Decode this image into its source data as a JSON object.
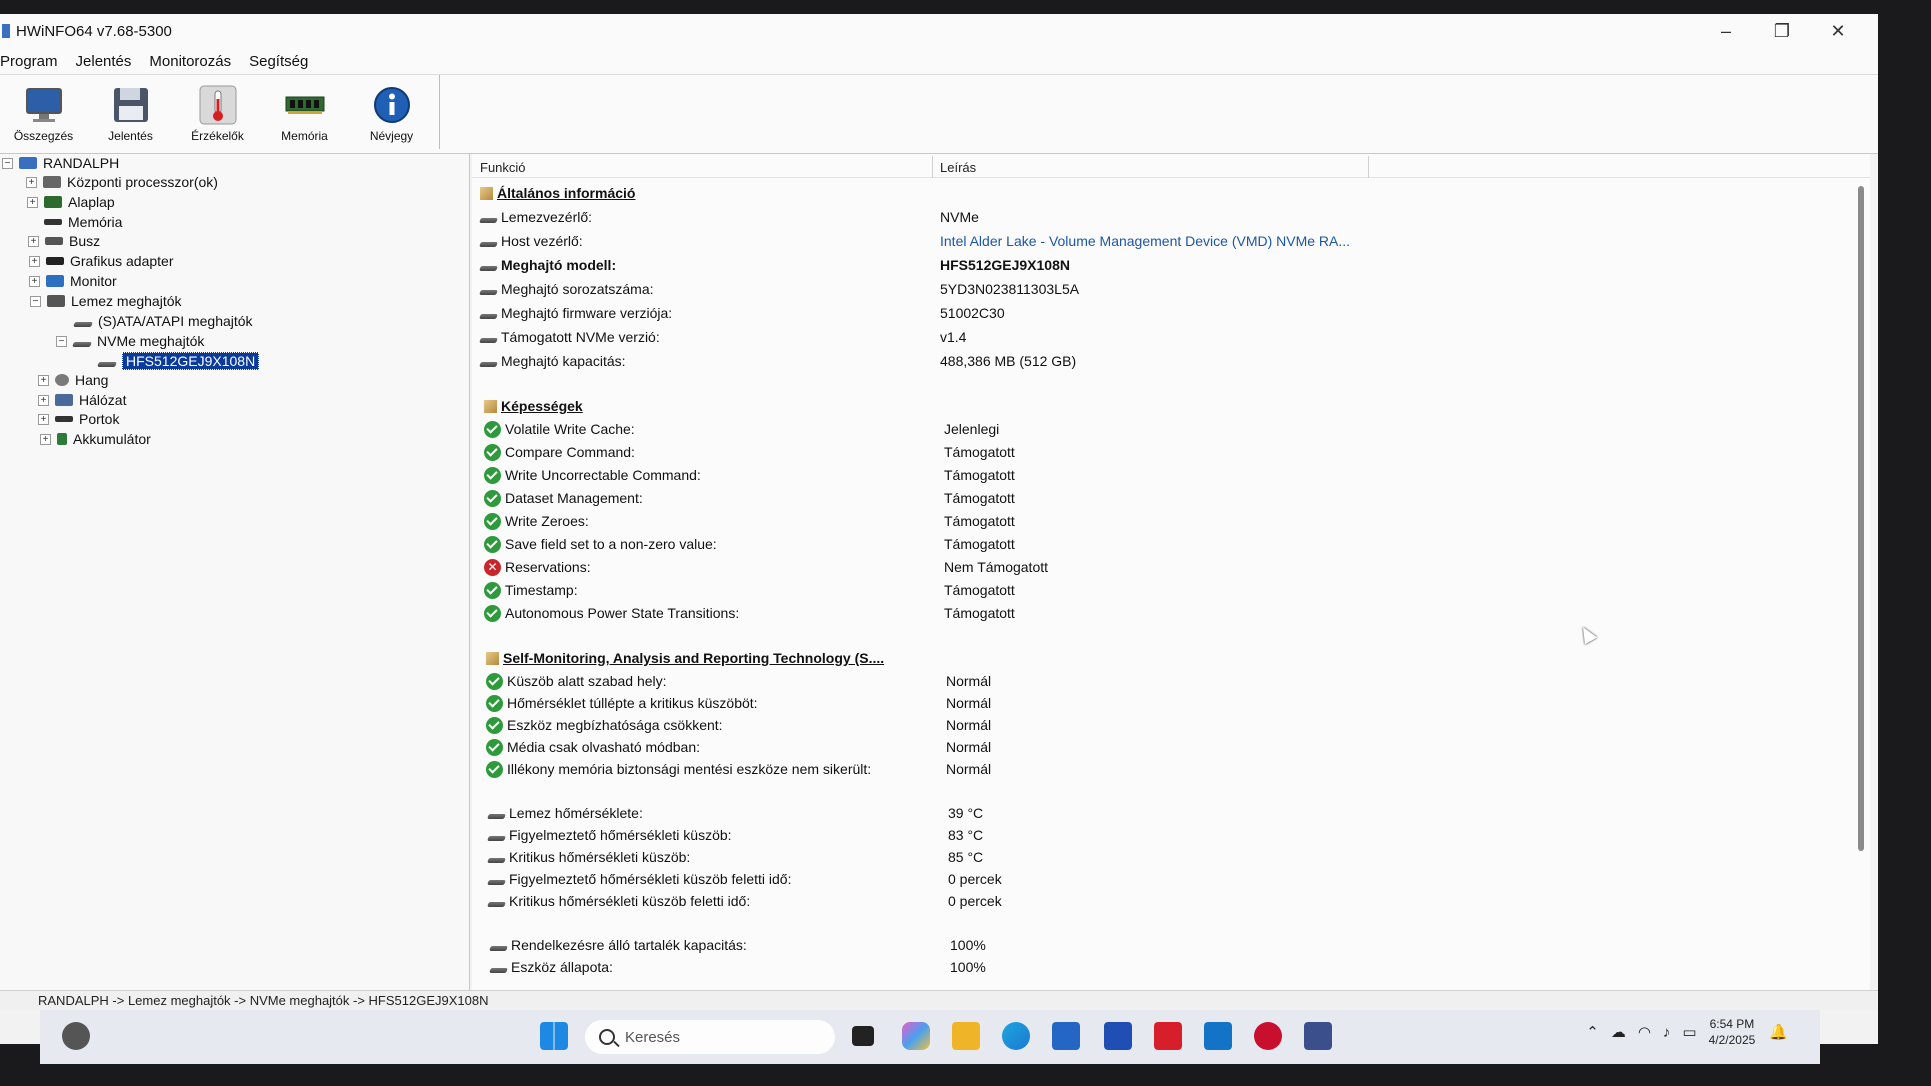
{
  "window": {
    "title": "HWiNFO64 v7.68-5300",
    "minimize_glyph": "–",
    "restore_glyph": "❐",
    "close_glyph": "✕"
  },
  "menu": [
    "Program",
    "Jelentés",
    "Monitorozás",
    "Segítség"
  ],
  "toolbar": [
    {
      "label": "Összegzés",
      "icon": "monitor-icon"
    },
    {
      "label": "Jelentés",
      "icon": "save-disk-icon"
    },
    {
      "label": "Érzékelők",
      "icon": "thermometer-icon"
    },
    {
      "label": "Memória",
      "icon": "memory-stick-icon"
    },
    {
      "label": "Névjegy",
      "icon": "info-icon"
    }
  ],
  "tree": {
    "root": "RANDALPH",
    "expand_glyph": "+",
    "collapse_glyph": "−",
    "items": [
      {
        "label": "Központi processzor(ok)",
        "icon": "cpu-icon"
      },
      {
        "label": "Alaplap",
        "icon": "motherboard-icon"
      },
      {
        "label": "Memória",
        "icon": "memory-icon"
      },
      {
        "label": "Busz",
        "icon": "bus-icon"
      },
      {
        "label": "Grafikus adapter",
        "icon": "gpu-icon"
      },
      {
        "label": "Monitor",
        "icon": "monitor-icon"
      },
      {
        "label": "Lemez meghajtók",
        "icon": "disk-icon"
      },
      {
        "label": "(S)ATA/ATAPI meghajtók",
        "icon": "drive-icon"
      },
      {
        "label": "NVMe meghajtók",
        "icon": "drive-icon"
      },
      {
        "label": "HFS512GEJ9X108N",
        "icon": "drive-icon"
      },
      {
        "label": "Hang",
        "icon": "speaker-icon"
      },
      {
        "label": "Hálózat",
        "icon": "network-icon"
      },
      {
        "label": "Portok",
        "icon": "port-icon"
      },
      {
        "label": "Akkumulátor",
        "icon": "battery-icon"
      }
    ]
  },
  "columns": {
    "feature": "Funkció",
    "description": "Leírás"
  },
  "sections": {
    "general": "Általános információ",
    "capabilities": "Képességek",
    "smart": "Self-Monitoring, Analysis and Reporting Technology (S...."
  },
  "general_rows": [
    {
      "label": "Lemezvezérlő:",
      "value": "NVMe"
    },
    {
      "label": "Host vezérlő:",
      "value": "Intel Alder Lake - Volume Management Device (VMD) NVMe RA..."
    },
    {
      "label": "Meghajtó modell:",
      "value": "HFS512GEJ9X108N"
    },
    {
      "label": "Meghajtó sorozatszáma:",
      "value": "5YD3N023811303L5A"
    },
    {
      "label": "Meghajtó firmware verziója:",
      "value": "51002C30"
    },
    {
      "label": "Támogatott NVMe verzió:",
      "value": "v1.4"
    },
    {
      "label": "Meghajtó kapacitás:",
      "value": "488,386 MB (512 GB)"
    }
  ],
  "capability_rows": [
    {
      "label": "Volatile Write Cache:",
      "value": "Jelenlegi",
      "status": "ok"
    },
    {
      "label": "Compare Command:",
      "value": "Támogatott",
      "status": "ok"
    },
    {
      "label": "Write Uncorrectable Command:",
      "value": "Támogatott",
      "status": "ok"
    },
    {
      "label": "Dataset Management:",
      "value": "Támogatott",
      "status": "ok"
    },
    {
      "label": "Write Zeroes:",
      "value": "Támogatott",
      "status": "ok"
    },
    {
      "label": "Save field set to a non-zero value:",
      "value": "Támogatott",
      "status": "ok"
    },
    {
      "label": "Reservations:",
      "value": "Nem Támogatott",
      "status": "error"
    },
    {
      "label": "Timestamp:",
      "value": "Támogatott",
      "status": "ok"
    },
    {
      "label": "Autonomous Power State Transitions:",
      "value": "Támogatott",
      "status": "ok"
    }
  ],
  "smart_rows": [
    {
      "label": "Küszöb alatt szabad hely:",
      "value": "Normál",
      "status": "ok"
    },
    {
      "label": "Hőmérséklet túllépte a kritikus küszöböt:",
      "value": "Normál",
      "status": "ok"
    },
    {
      "label": "Eszköz megbízhatósága csökkent:",
      "value": "Normál",
      "status": "ok"
    },
    {
      "label": "Média csak olvasható módban:",
      "value": "Normál",
      "status": "ok"
    },
    {
      "label": "Illékony memória biztonsági mentési eszköze nem sikerült:",
      "value": "Normál",
      "status": "ok"
    }
  ],
  "temp_rows": [
    {
      "label": "Lemez hőmérséklete:",
      "value": "39 °C"
    },
    {
      "label": "Figyelmeztető hőmérsékleti küszöb:",
      "value": "83 °C"
    },
    {
      "label": "Kritikus hőmérsékleti küszöb:",
      "value": "85 °C"
    },
    {
      "label": "Figyelmeztető hőmérsékleti küszöb feletti idő:",
      "value": "0 percek"
    },
    {
      "label": "Kritikus hőmérsékleti küszöb feletti idő:",
      "value": "0 percek"
    }
  ],
  "health_rows": [
    {
      "label": "Rendelkezésre álló tartalék kapacitás:",
      "value": "100%"
    },
    {
      "label": "Eszköz állapota:",
      "value": "100%"
    }
  ],
  "statusbar": "RANDALPH -> Lemez meghajtók -> NVMe meghajtók -> HFS512GEJ9X108N",
  "taskbar": {
    "search_placeholder": "Keresés",
    "time": "6:54 PM",
    "date": "4/2/2025",
    "apps": [
      "widgets-icon",
      "windows-start-icon",
      "task-view-icon",
      "copilot-icon",
      "file-explorer-icon",
      "edge-icon",
      "store-icon",
      "app-icon",
      "mcafee-icon",
      "outlook-icon",
      "record-icon",
      "hwinfo-icon"
    ]
  }
}
